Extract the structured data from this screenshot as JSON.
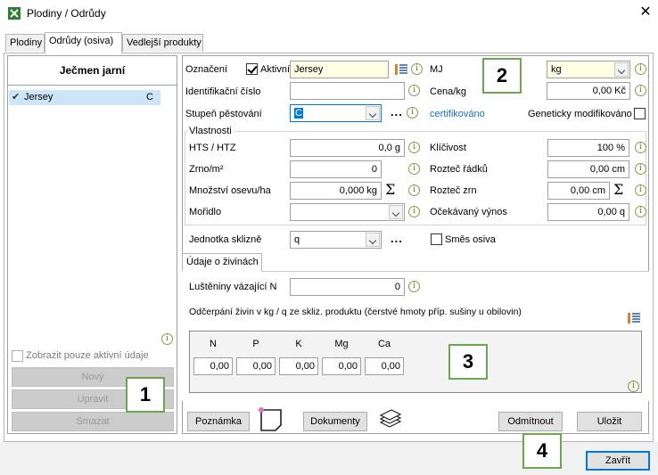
{
  "window": {
    "title": "Plodiny / Odrůdy",
    "close_glyph": "✕"
  },
  "tabs": [
    {
      "label": "Plodiny"
    },
    {
      "label": "Odrůdy (osiva)"
    },
    {
      "label": "Vedlejší produkty"
    }
  ],
  "left_panel": {
    "title": "Ječmen jarní",
    "items": [
      {
        "check": "✔",
        "label": "Jersey",
        "code": "C"
      }
    ],
    "show_active_label": "Zobrazit pouze aktivní údaje",
    "buttons": {
      "new": "Nový",
      "edit": "Upravit",
      "delete": "Smazat"
    }
  },
  "form": {
    "oznaceni_label": "Označení",
    "aktivni_label": "Aktivní",
    "oznaceni_value": "Jersey",
    "mj_label": "MJ",
    "mj_value": "kg",
    "ident_label": "Identifikační číslo",
    "ident_value": "",
    "cena_label": "Cena/kg",
    "cena_value": "0,00 Kč",
    "stupen_label": "Stupeň pěstování",
    "stupen_value": "C",
    "certifikovano": "certifikováno",
    "geneticky_label": "Geneticky modifikováno",
    "vlastnosti_label": "Vlastnosti",
    "hts_label": "HTS / HTZ",
    "hts_value": "0,0 g",
    "klicivost_label": "Klíčivost",
    "klicivost_value": "100 %",
    "zrno_label": "Zrno/m²",
    "zrno_value": "0",
    "roztec_radku_label": "Rozteč řádků",
    "roztec_radku_value": "0,00 cm",
    "mnozstvi_label": "Množství osevu/ha",
    "mnozstvi_value": "0,000 kg",
    "roztec_zrn_label": "Rozteč zrn",
    "roztec_zrn_value": "0,00 cm",
    "moridlo_label": "Mořidlo",
    "moridlo_value": "",
    "vynos_label": "Očekávaný výnos",
    "vynos_value": "0,00 q",
    "jednotka_label": "Jednotka sklizně",
    "jednotka_value": "q",
    "smes_label": "Směs osiva"
  },
  "nutrients": {
    "tab_label": "Údaje o živinách",
    "lusteniny_label": "Luštěniny vázající N",
    "lusteniny_value": "0",
    "odcerpani_label": "Odčerpání živin v kg / q ze skliz. produktu (čerstvé hmoty příp. sušiny u obilovin)",
    "columns": [
      {
        "name": "N",
        "value": "0,00"
      },
      {
        "name": "P",
        "value": "0,00"
      },
      {
        "name": "K",
        "value": "0,00"
      },
      {
        "name": "Mg",
        "value": "0,00"
      },
      {
        "name": "Ca",
        "value": "0,00"
      }
    ]
  },
  "bottom_buttons": {
    "poznamka": "Poznámka",
    "dokumenty": "Dokumenty",
    "odmitnout": "Odmítnout",
    "ulozit": "Uložit",
    "zavrit": "Zavřít"
  },
  "callouts": {
    "c1": "1",
    "c2": "2",
    "c3": "3",
    "c4": "4"
  },
  "icons": {
    "info_glyph": "i",
    "sigma_glyph": "Σ",
    "dots_glyph": "..."
  },
  "colors": {
    "accent_green": "#6aa84f",
    "selection_blue": "#cde6f7",
    "link_blue": "#1e6fbf",
    "yellow_field": "#ffffe6"
  }
}
